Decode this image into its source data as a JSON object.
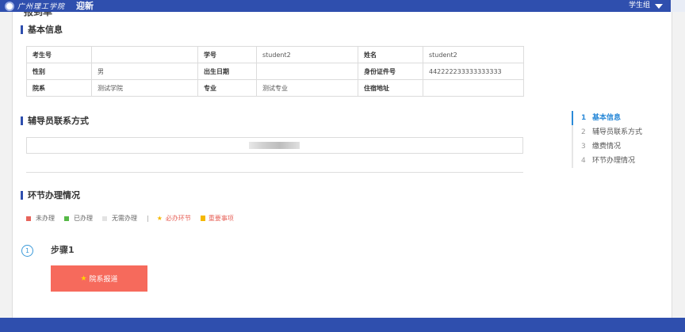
{
  "header": {
    "logo_text": "广州理工学院",
    "app_title": "迎新",
    "user_role": "学生组"
  },
  "page": {
    "cut_title": "报到单"
  },
  "basic_info": {
    "title": "基本信息",
    "rows": [
      [
        {
          "label": "考生号",
          "value": ""
        },
        {
          "label": "学号",
          "value": "student2"
        },
        {
          "label": "姓名",
          "value": "student2"
        }
      ],
      [
        {
          "label": "性别",
          "value": "男"
        },
        {
          "label": "出生日期",
          "value": ""
        },
        {
          "label": "身份证件号",
          "value": "442222233333333333"
        }
      ],
      [
        {
          "label": "院系",
          "value": "测试学院"
        },
        {
          "label": "专业",
          "value": "测试专业"
        },
        {
          "label": "住宿地址",
          "value": ""
        }
      ]
    ]
  },
  "counselor": {
    "title": "辅导员联系方式"
  },
  "process": {
    "title": "环节办理情况",
    "legend": {
      "not_done": "未办理",
      "done": "已办理",
      "not_required": "无需办理",
      "separator": "|",
      "required": "必办环节",
      "important": "重要事项"
    },
    "colors": {
      "not_done": "#e7645b",
      "done": "#56b947",
      "not_required": "#e3e3e3",
      "accent": "#f5b800"
    },
    "steps": [
      {
        "number": "1",
        "title": "步骤1",
        "button_label": "院系报道"
      }
    ]
  },
  "side_nav": {
    "items": [
      {
        "number": "1",
        "label": "基本信息",
        "active": true
      },
      {
        "number": "2",
        "label": "辅导员联系方式",
        "active": false
      },
      {
        "number": "3",
        "label": "缴费情况",
        "active": false
      },
      {
        "number": "4",
        "label": "环节办理情况",
        "active": false
      }
    ]
  },
  "theme": {
    "primary": "#2f4fae",
    "nav_active": "#2b8ad8",
    "button": "#f66a5c"
  }
}
